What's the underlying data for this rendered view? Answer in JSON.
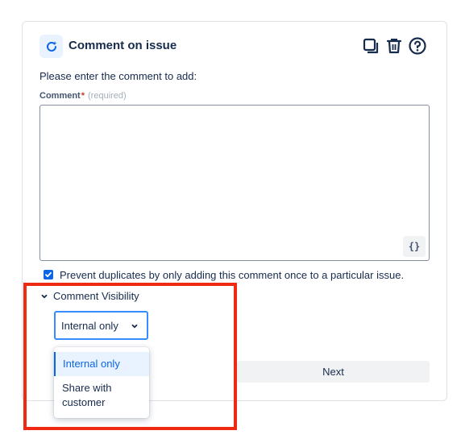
{
  "header": {
    "title": "Comment on issue",
    "icons": [
      "refresh-sparkle-icon",
      "duplicate-icon",
      "trash-icon",
      "help-icon"
    ]
  },
  "form": {
    "prompt": "Please enter the comment to add:",
    "comment_label": "Comment",
    "required_mark": "*",
    "required_hint": "(required)",
    "comment_value": "",
    "expression_button": "{}",
    "prevent_duplicates_label": "Prevent duplicates by only adding this comment once to a particular issue.",
    "prevent_duplicates_checked": true
  },
  "visibility": {
    "toggle_label": "Comment Visibility",
    "selected": "Internal only",
    "options": [
      "Internal only",
      "Share with customer"
    ]
  },
  "footer": {
    "next_label": "Next"
  },
  "colors": {
    "accent": "#0c66e4",
    "highlight": "#ee2b12",
    "selected_bg": "#e9f2ff"
  }
}
